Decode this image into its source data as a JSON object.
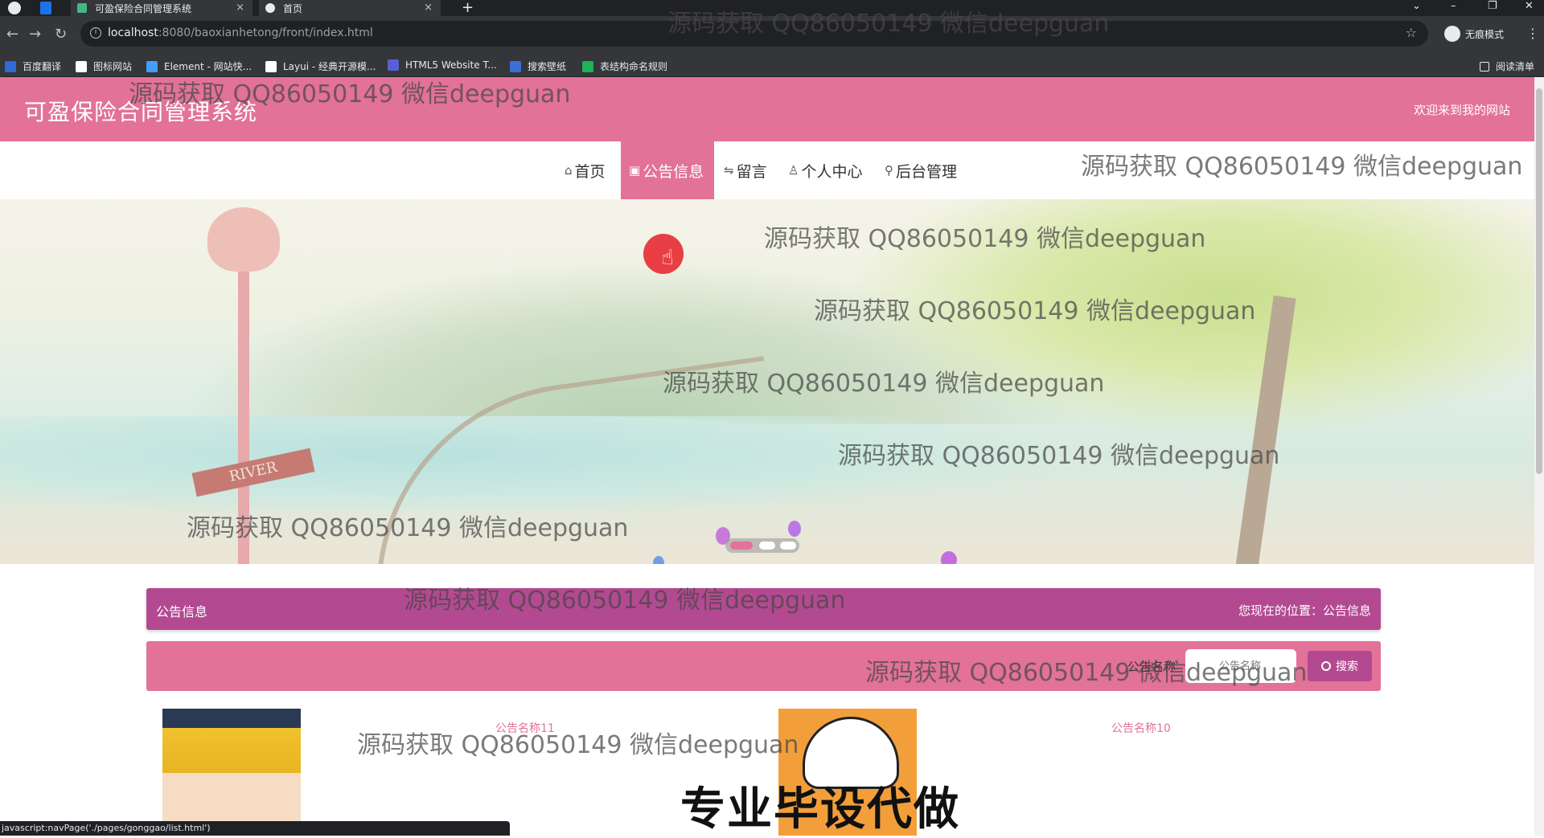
{
  "browser": {
    "tabs": [
      {
        "title": "可盈保险合同管理系统",
        "close": "×"
      },
      {
        "title": "首页",
        "close": "×"
      }
    ],
    "new_tab": "+",
    "url_host": "localhost",
    "url_rest": ":8080/baoxianhetong/front/index.html",
    "incognito_label": "无痕模式",
    "reading_list": "阅读清单",
    "bookmarks": [
      {
        "label": "百度翻译",
        "color": "#2f6bd8"
      },
      {
        "label": "图标网站",
        "color": "#ffffff"
      },
      {
        "label": "Element - 网站快...",
        "color": "#409eff"
      },
      {
        "label": "Layui - 经典开源模...",
        "color": "#ffffff"
      },
      {
        "label": "HTML5 Website T...",
        "color": "#5a5fd8"
      },
      {
        "label": "搜索壁纸",
        "color": "#3b6fd8"
      },
      {
        "label": "表结构命名规则",
        "color": "#1fb25a"
      }
    ],
    "status_text": "javascript:navPage('./pages/gonggao/list.html')"
  },
  "site": {
    "title": "可盈保险合同管理系统",
    "welcome": "欢迎来到我的网站",
    "nav": [
      {
        "icon": "⌂",
        "label": "首页"
      },
      {
        "icon": "▣",
        "label": "公告信息"
      },
      {
        "icon": "⇋",
        "label": "留言"
      },
      {
        "icon": "♙",
        "label": "个人中心"
      },
      {
        "icon": "⚲",
        "label": "后台管理"
      }
    ],
    "active_nav": 1,
    "banner": {
      "sign_text": "RIVER",
      "slides": 3,
      "active_slide": 0
    },
    "crumb": {
      "title": "公告信息",
      "position": "您现在的位置：公告信息"
    },
    "search": {
      "label": "公告名称",
      "placeholder": "公告名称",
      "button": "搜索"
    },
    "cards": [
      {
        "name": "公告名称11",
        "thumb": "conan-avatar"
      },
      {
        "name": "公告名称10",
        "thumb": "shinchan-avatar"
      }
    ]
  },
  "overlay": {
    "watermark": "源码获取 QQ86050149 微信deepguan",
    "promo": "专业毕设代做"
  },
  "colors": {
    "header_pink": "#e27297",
    "crumb_purple": "#b34a91",
    "card_title": "#e27297"
  }
}
